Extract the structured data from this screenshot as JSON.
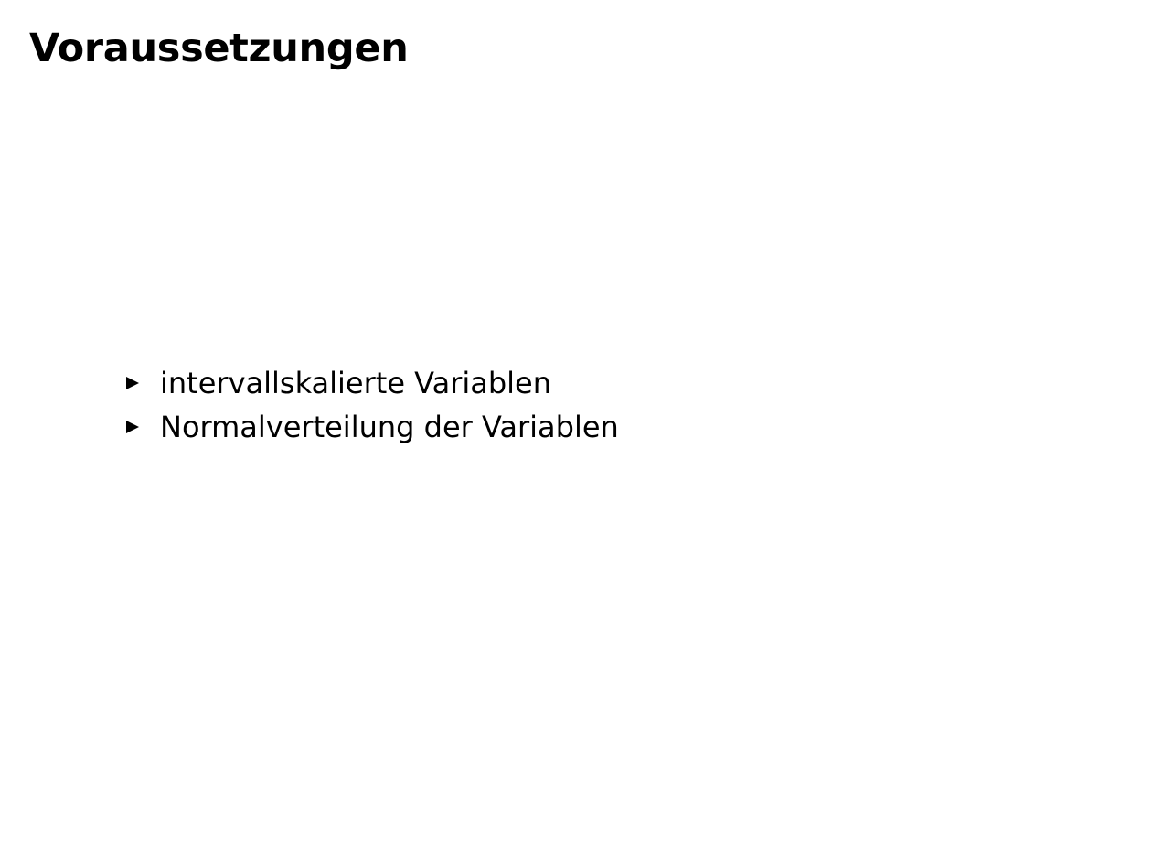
{
  "slide": {
    "title": "Voraussetzungen",
    "bullets": [
      {
        "text": "intervallskalierte Variablen",
        "icon": "triangle-bullet-icon"
      },
      {
        "text": "Normalverteilung der Variablen",
        "icon": "triangle-bullet-icon"
      }
    ]
  },
  "colors": {
    "background": "#ffffff",
    "text": "#000000"
  }
}
